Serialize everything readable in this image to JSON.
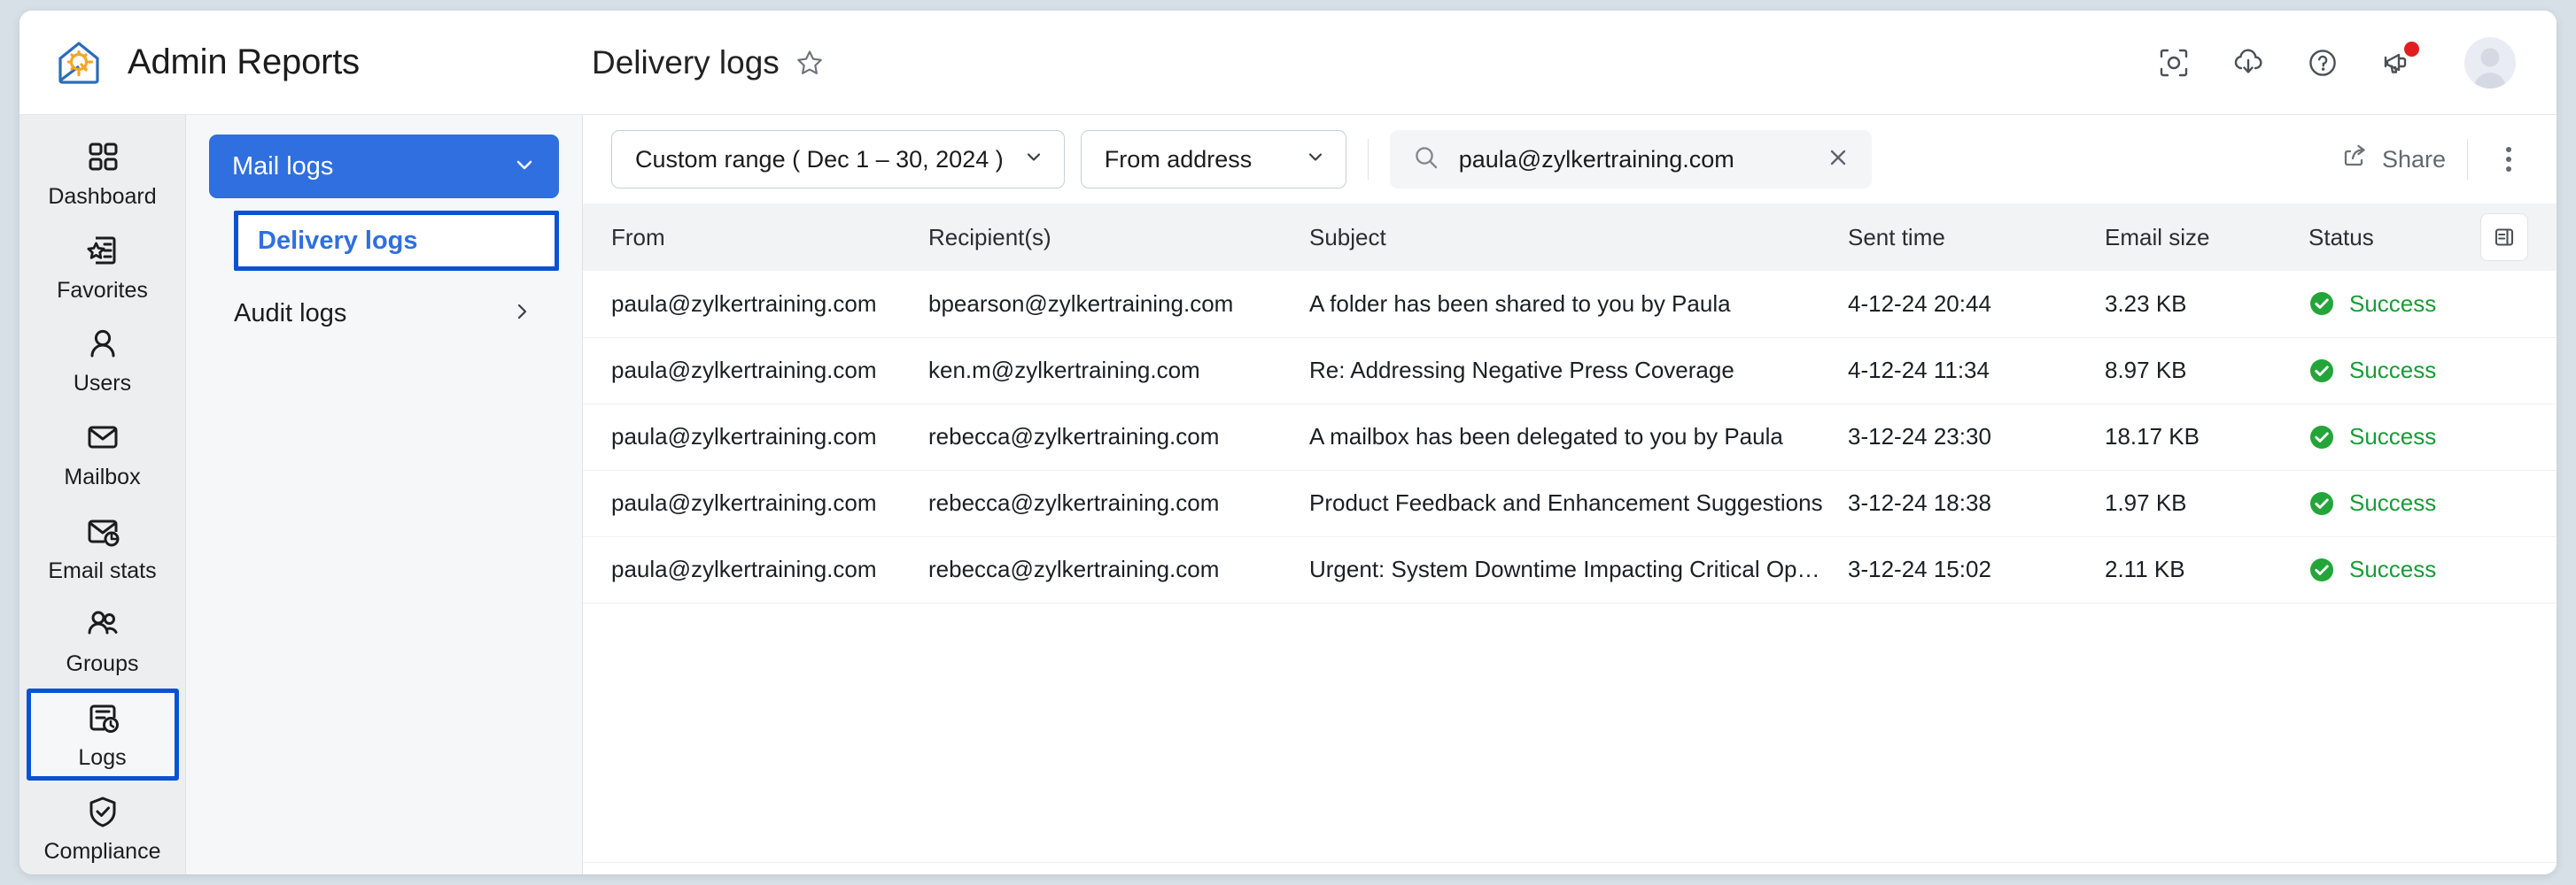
{
  "brand": {
    "title": "Admin Reports",
    "logo_icon": "house-gear-icon"
  },
  "header": {
    "page_title": "Delivery logs",
    "favorite_icon": "star-icon",
    "actions": [
      {
        "name": "screenshot-icon",
        "label": "Screenshot"
      },
      {
        "name": "cloud-download-icon",
        "label": "Download"
      },
      {
        "name": "help-icon",
        "label": "Help"
      },
      {
        "name": "announcements-icon",
        "label": "Announcements",
        "badge": true
      }
    ],
    "avatar_label": "Profile"
  },
  "rail": {
    "items": [
      {
        "label": "Dashboard",
        "icon": "grid-icon",
        "active": false
      },
      {
        "label": "Favorites",
        "icon": "star-doc-icon",
        "active": false
      },
      {
        "label": "Users",
        "icon": "user-icon",
        "active": false
      },
      {
        "label": "Mailbox",
        "icon": "envelope-icon",
        "active": false
      },
      {
        "label": "Email stats",
        "icon": "mail-chart-icon",
        "active": false
      },
      {
        "label": "Groups",
        "icon": "groups-icon",
        "active": false
      },
      {
        "label": "Logs",
        "icon": "log-clock-icon",
        "active": true
      },
      {
        "label": "Compliance",
        "icon": "shield-check-icon",
        "active": false
      }
    ]
  },
  "subnav": {
    "header_label": "Mail logs",
    "header_chevron": "chevron-down-icon",
    "items": [
      {
        "label": "Delivery logs",
        "selected": true,
        "chevron": ""
      },
      {
        "label": "Audit logs",
        "selected": false,
        "chevron": "chevron-right-icon"
      }
    ]
  },
  "filters": {
    "date_range_label": "Custom range ( Dec 1 – 30, 2024 )",
    "from_address_label": "From address",
    "search": {
      "value": "paula@zylkertraining.com",
      "placeholder": "Search",
      "icon": "search-icon",
      "clear_icon": "close-icon"
    },
    "share_label": "Share",
    "share_icon": "share-icon",
    "more_icon": "kebab-menu-icon"
  },
  "table": {
    "columns": [
      "From",
      "Recipient(s)",
      "Subject",
      "Sent time",
      "Email size",
      "Status"
    ],
    "column_toggle_icon": "column-settings-icon",
    "rows": [
      {
        "from": "paula@zylkertraining.com",
        "recipients": "bpearson@zylkertraining.com",
        "subject": "A folder has been shared to you by Paula",
        "sent_time": "4-12-24 20:44",
        "email_size": "3.23 KB",
        "status": "Success"
      },
      {
        "from": "paula@zylkertraining.com",
        "recipients": "ken.m@zylkertraining.com",
        "subject": "Re: Addressing Negative Press Coverage",
        "sent_time": "4-12-24 11:34",
        "email_size": "8.97 KB",
        "status": "Success"
      },
      {
        "from": "paula@zylkertraining.com",
        "recipients": "rebecca@zylkertraining.com",
        "subject": "A mailbox has been delegated to you by Paula",
        "sent_time": "3-12-24 23:30",
        "email_size": "18.17 KB",
        "status": "Success"
      },
      {
        "from": "paula@zylkertraining.com",
        "recipients": "rebecca@zylkertraining.com",
        "subject": "Product Feedback and Enhancement Suggestions",
        "sent_time": "3-12-24 18:38",
        "email_size": "1.97 KB",
        "status": "Success"
      },
      {
        "from": "paula@zylkertraining.com",
        "recipients": "rebecca@zylkertraining.com",
        "subject": "Urgent: System Downtime Impacting Critical Operations",
        "sent_time": "3-12-24 15:02",
        "email_size": "2.11 KB",
        "status": "Success"
      }
    ]
  },
  "colors": {
    "accent_blue": "#2f6fe0",
    "selection_blue": "#0a52d4",
    "success_green": "#1a9b37",
    "badge_red": "#e02020",
    "logo_orange": "#f5a623",
    "page_bg": "#d6e0e6"
  }
}
